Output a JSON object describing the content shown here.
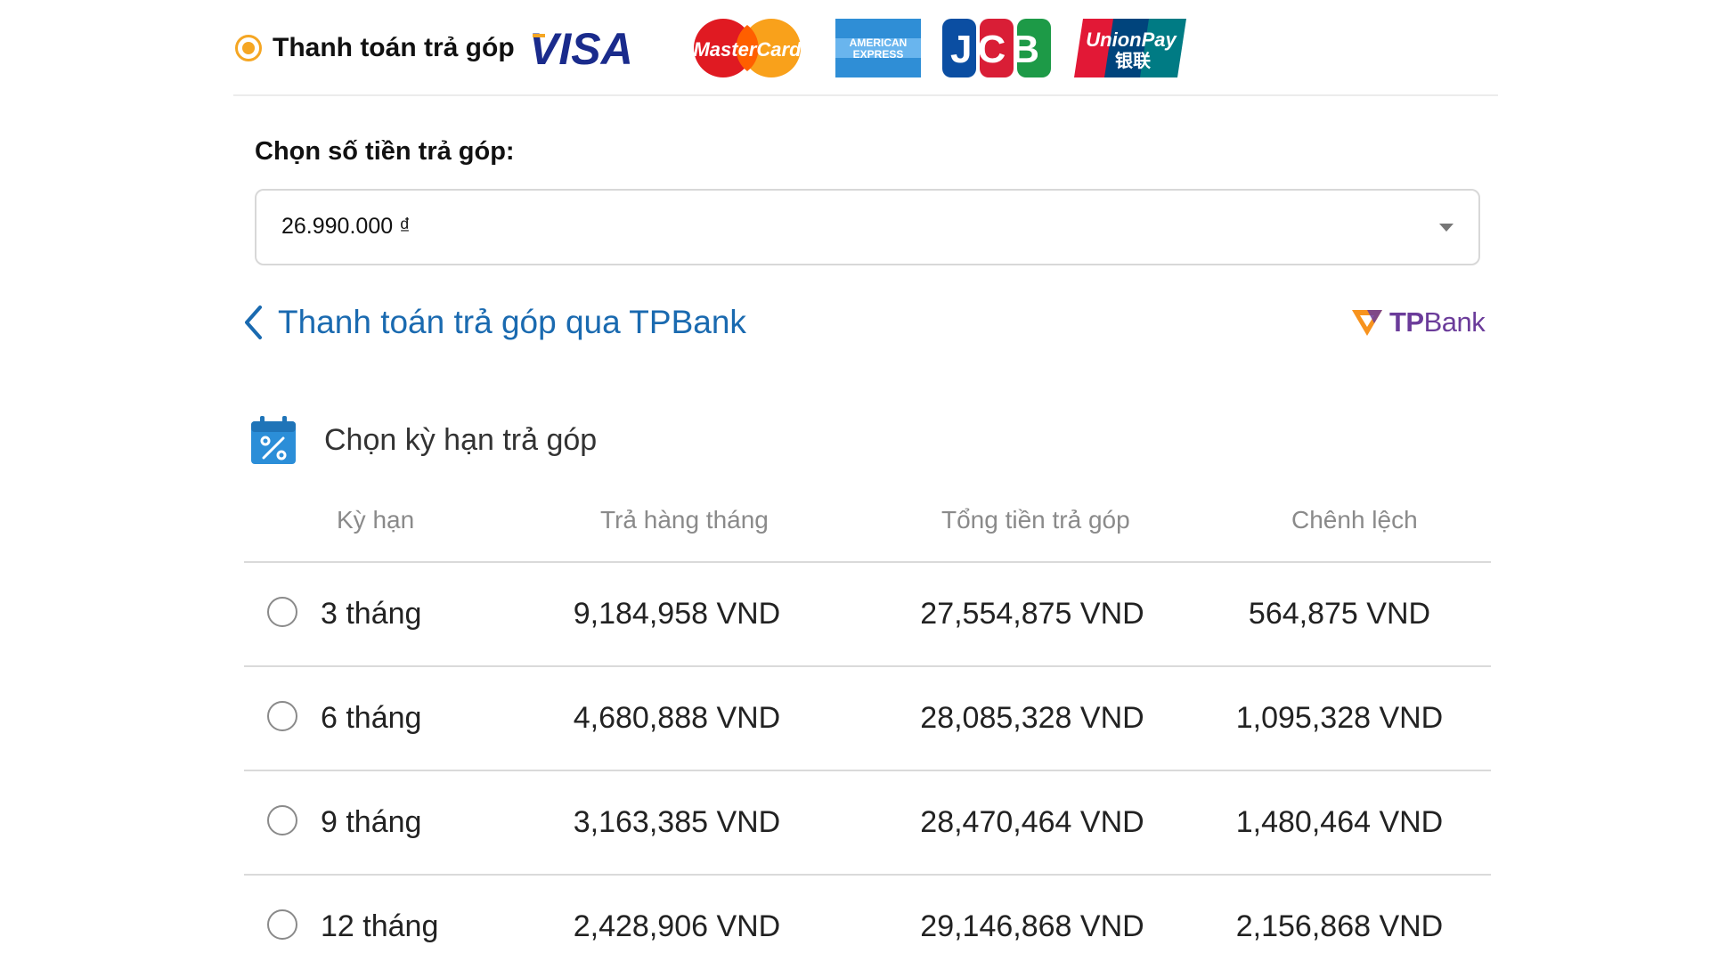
{
  "payment": {
    "method_label": "Thanh toán trả góp",
    "cards": [
      "visa-logo",
      "mastercard-logo",
      "amex-logo",
      "jcb-logo",
      "unionpay-logo"
    ],
    "card_text": {
      "visa": "VISA",
      "mastercard": "MasterCard",
      "amex_top": "AMERICAN",
      "amex_bottom": "EXPRESS",
      "jcb": "JCB",
      "unionpay": "UnionPay",
      "unionpay_cn": "银联"
    }
  },
  "amount": {
    "label": "Chọn số tiền trả góp:",
    "selected": "26.990.000 ₫"
  },
  "bank": {
    "back_label": "Thanh toán trả góp qua TPBank",
    "logo_tp": "TP",
    "logo_bank": "Bank"
  },
  "terms": {
    "title": "Chọn kỳ hạn trả góp",
    "headers": [
      "Kỳ hạn",
      "Trả hàng tháng",
      "Tổng tiền trả góp",
      "Chênh lệch"
    ],
    "rows": [
      {
        "term": "3 tháng",
        "monthly": "9,184,958 VND",
        "total": "27,554,875 VND",
        "diff": "564,875 VND"
      },
      {
        "term": "6 tháng",
        "monthly": "4,680,888 VND",
        "total": "28,085,328 VND",
        "diff": "1,095,328 VND"
      },
      {
        "term": "9 tháng",
        "monthly": "3,163,385 VND",
        "total": "28,470,464 VND",
        "diff": "1,480,464 VND"
      },
      {
        "term": "12 tháng",
        "monthly": "2,428,906 VND",
        "total": "29,146,868 VND",
        "diff": "2,156,868 VND"
      }
    ]
  },
  "colors": {
    "accent": "#f5a623",
    "link": "#1a6ab0",
    "tpbank_purple": "#6b3c9a",
    "tpbank_orange": "#f7931e"
  }
}
